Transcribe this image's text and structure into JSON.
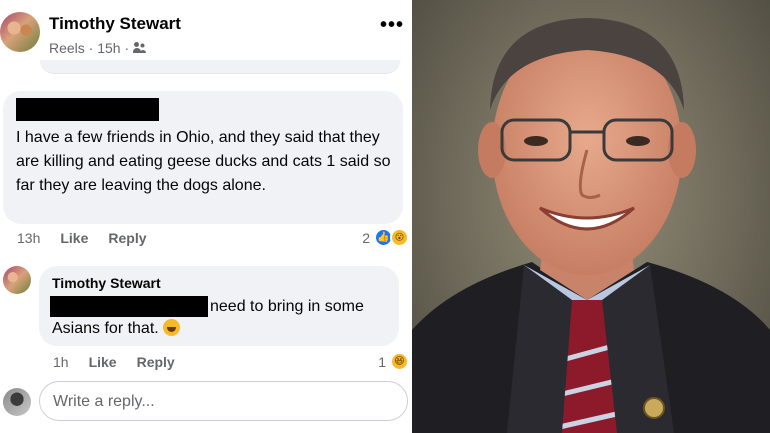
{
  "post": {
    "author": "Timothy Stewart",
    "meta": "Reels · 15h ·",
    "more": "•••"
  },
  "comment": {
    "text": "I have a few friends in Ohio, and they said that they are killing and eating geese ducks and cats 1 said so far they are leaving the dogs alone.",
    "time": "13h",
    "like": "Like",
    "reply": "Reply",
    "reaction_count": "2"
  },
  "reply": {
    "author": "Timothy Stewart",
    "text_line1": "need to bring in some",
    "text_line2": "Asians for that.",
    "time": "1h",
    "like": "Like",
    "reply": "Reply",
    "reaction_count": "1"
  },
  "composer": {
    "placeholder": "Write a reply..."
  },
  "colors": {
    "bubble": "#f0f2f5",
    "secondary_text": "#65676b",
    "like_blue": "#1877f2",
    "emoji_yellow": "#f7b928"
  }
}
